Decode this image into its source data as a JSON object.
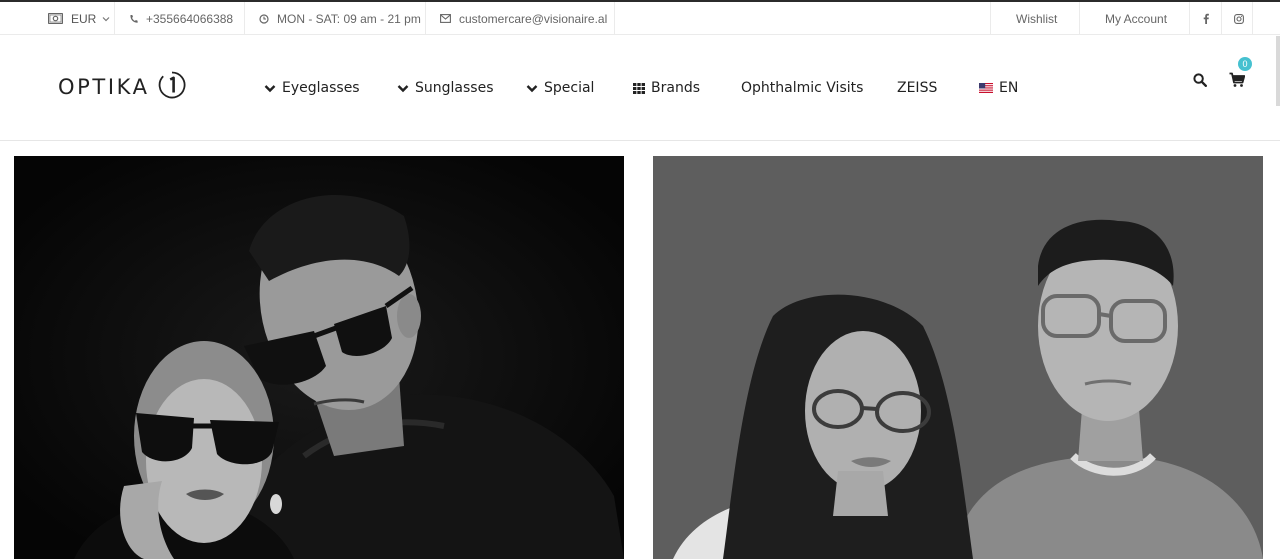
{
  "topbar": {
    "currency": "EUR",
    "phone": "+355664066388",
    "hours": "MON - SAT: 09 am - 21 pm",
    "email": "customercare@visionaire.al",
    "wishlist": "Wishlist",
    "my_account": "My Account"
  },
  "header": {
    "logo_text": "OPTIKA",
    "logo_mark": "1",
    "nav": [
      {
        "label": "Eyeglasses",
        "icon": "chevron-down-icon"
      },
      {
        "label": "Sunglasses",
        "icon": "chevron-down-icon"
      },
      {
        "label": "Special",
        "icon": "chevron-down-icon"
      },
      {
        "label": "Brands",
        "icon": "grid-icon"
      },
      {
        "label": "Ophthalmic Visits"
      },
      {
        "label": "ZEISS"
      },
      {
        "label": "EN",
        "icon": "us-flag-icon"
      }
    ],
    "cart_count": "0"
  },
  "colors": {
    "accent": "#46c1d0",
    "text": "#222222",
    "muted": "#666666"
  }
}
